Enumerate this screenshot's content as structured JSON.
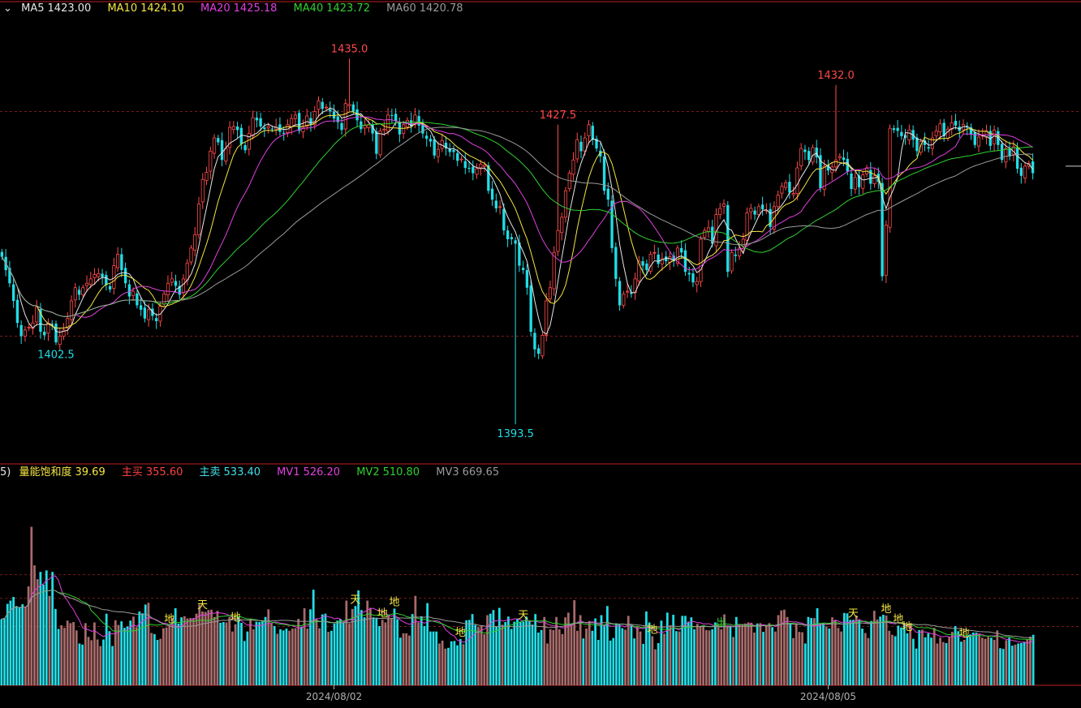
{
  "legend": {
    "ma": [
      {
        "label": "MA5",
        "value": "1423.00",
        "color": "#e6e6e6"
      },
      {
        "label": "MA10",
        "value": "1424.10",
        "color": "#f5e642"
      },
      {
        "label": "MA20",
        "value": "1425.18",
        "color": "#e040e0"
      },
      {
        "label": "MA40",
        "value": "1423.72",
        "color": "#30d030"
      },
      {
        "label": "MA60",
        "value": "1420.78",
        "color": "#9a9a9a"
      }
    ],
    "vol_prefix": "5)",
    "vol": [
      {
        "label": "量能饱和度",
        "value": "39.69",
        "color": "#f5e642"
      },
      {
        "label": "主买",
        "value": "355.60",
        "color": "#ff4040"
      },
      {
        "label": "主卖",
        "value": "533.40",
        "color": "#40e0e8"
      },
      {
        "label": "MV1",
        "value": "526.20",
        "color": "#e040e0"
      },
      {
        "label": "MV2",
        "value": "510.80",
        "color": "#30d030"
      },
      {
        "label": "MV3",
        "value": "669.65",
        "color": "#9a9a9a"
      }
    ]
  },
  "colors": {
    "up": "#ff4a4a",
    "down": "#22dde6",
    "grid": "#7a1a1a",
    "frame": "#c02020",
    "axis_text": "#b0b0b0"
  },
  "chart_data": [
    {
      "type": "candlestick",
      "ylim": [
        1389,
        1440
      ],
      "annotations": [
        {
          "label": "1435.0",
          "index": 90
        },
        {
          "label": "1402.5",
          "index": 14
        },
        {
          "label": "1427.5",
          "index": 144
        },
        {
          "label": "1393.5",
          "index": 133
        },
        {
          "label": "1432.0",
          "index": 216
        }
      ],
      "x_ticks": [
        {
          "label": "2024/08/02",
          "index": 86
        },
        {
          "label": "2024/08/05",
          "index": 214
        }
      ],
      "guide_levels": [
        1429.0,
        1403.5
      ],
      "right_marker": 1422.8,
      "close": [
        1412.5,
        1411.0,
        1409.5,
        1407.5,
        1405.0,
        1403.5,
        1404.2,
        1404.5,
        1405.0,
        1406.8,
        1404.0,
        1403.6,
        1405.0,
        1404.8,
        1402.8,
        1403.5,
        1404.2,
        1405.5,
        1407.5,
        1409.0,
        1408.2,
        1409.0,
        1409.5,
        1410.0,
        1410.5,
        1410.6,
        1410.2,
        1409.3,
        1408.8,
        1411.5,
        1412.8,
        1411.0,
        1409.5,
        1408.0,
        1408.6,
        1407.0,
        1406.5,
        1405.5,
        1406.5,
        1405.8,
        1405.2,
        1406.9,
        1408.3,
        1409.5,
        1410.0,
        1409.2,
        1408.2,
        1410.0,
        1411.8,
        1413.5,
        1415.0,
        1418.5,
        1421.3,
        1422.1,
        1424.5,
        1426.0,
        1425.5,
        1423.5,
        1424.8,
        1427.2,
        1427.3,
        1426.9,
        1425.3,
        1424.6,
        1426.5,
        1428.3,
        1428.0,
        1427.3,
        1427.0,
        1427.3,
        1427.0,
        1427.3,
        1426.7,
        1426.5,
        1427.5,
        1428.2,
        1428.6,
        1426.8,
        1427.2,
        1428.5,
        1427.5,
        1429.0,
        1430.2,
        1429.3,
        1429.5,
        1429.0,
        1428.2,
        1427.8,
        1426.9,
        1429.9,
        1429.8,
        1429.0,
        1428.0,
        1427.0,
        1427.4,
        1427.5,
        1426.5,
        1424.2,
        1426.8,
        1427.0,
        1428.6,
        1428.5,
        1427.9,
        1426.4,
        1427.5,
        1428.0,
        1427.3,
        1428.6,
        1427.4,
        1426.5,
        1425.9,
        1425.6,
        1424.0,
        1424.7,
        1425.7,
        1424.8,
        1424.4,
        1424.4,
        1423.4,
        1423.6,
        1422.6,
        1422.5,
        1422.0,
        1422.5,
        1423.0,
        1422.9,
        1420.0,
        1419.0,
        1418.0,
        1418.2,
        1415.5,
        1414.5,
        1414.5,
        1414.0,
        1411.5,
        1411.0,
        1409.0,
        1404.0,
        1402.0,
        1401.5,
        1403.6,
        1407.5,
        1409.0,
        1413.0,
        1415.5,
        1417.0,
        1420.0,
        1422.0,
        1423.5,
        1425.8,
        1424.5,
        1426.0,
        1427.5,
        1425.8,
        1424.8,
        1423.9,
        1420.0,
        1419.0,
        1413.5,
        1410.0,
        1407.0,
        1408.3,
        1408.6,
        1408.3,
        1410.0,
        1412.0,
        1411.5,
        1411.0,
        1412.8,
        1413.0,
        1411.7,
        1412.3,
        1412.0,
        1412.5,
        1412.0,
        1413.5,
        1413.0,
        1410.8,
        1410.5,
        1409.6,
        1409.7,
        1414.5,
        1415.5,
        1415.8,
        1414.0,
        1417.3,
        1418.0,
        1418.5,
        1410.8,
        1413.0,
        1412.6,
        1413.5,
        1414.5,
        1417.5,
        1418.0,
        1417.3,
        1418.2,
        1417.9,
        1417.8,
        1415.9,
        1418.2,
        1419.5,
        1420.5,
        1420.9,
        1419.8,
        1419.7,
        1422.6,
        1424.8,
        1424.4,
        1423.5,
        1424.9,
        1423.8,
        1420.3,
        1422.8,
        1422.3,
        1422.7,
        1423.5,
        1423.9,
        1423.5,
        1422.2,
        1420.2,
        1421.5,
        1420.4,
        1421.8,
        1422.6,
        1420.8,
        1421.7,
        1421.0,
        1410.3,
        1416.1,
        1427.1,
        1426.9,
        1426.8,
        1426.2,
        1426.0,
        1426.9,
        1425.8,
        1424.5,
        1425.6,
        1425.2,
        1424.8,
        1426.0,
        1426.8,
        1427.6,
        1426.2,
        1427.0,
        1427.7,
        1427.4,
        1426.8,
        1427.5,
        1427.2,
        1426.4,
        1425.2,
        1426.1,
        1426.3,
        1426.8,
        1425.1,
        1426.9,
        1425.2,
        1423.5,
        1424.8,
        1423.9,
        1425.0,
        1422.5,
        1421.7,
        1422.8,
        1423.1,
        1422.0
      ]
    },
    {
      "type": "bar",
      "series_levels": [
        355.6,
        533.4,
        526.2,
        510.8,
        669.65
      ],
      "markers": [
        {
          "label": "天",
          "index": 67
        },
        {
          "label": "地",
          "index": 56
        },
        {
          "label": "地",
          "index": 78
        },
        {
          "label": "天",
          "index": 118
        },
        {
          "label": "天",
          "index": 174
        },
        {
          "label": "地",
          "index": 127
        },
        {
          "label": "地",
          "index": 131
        },
        {
          "label": "地",
          "index": 153
        },
        {
          "label": "地",
          "index": 217
        },
        {
          "label": "出",
          "index": 240
        },
        {
          "label": "天",
          "index": 284
        },
        {
          "label": "地",
          "index": 295
        },
        {
          "label": "地",
          "index": 299
        },
        {
          "label": "地",
          "index": 302
        },
        {
          "label": "地",
          "index": 321
        }
      ],
      "values": [
        182,
        185,
        224,
        233,
        243,
        218,
        214,
        223,
        216,
        272,
        436,
        330,
        292,
        312,
        277,
        316,
        246,
        312,
        210,
        155,
        165,
        158,
        178,
        171,
        174,
        151,
        115,
        112,
        171,
        133,
        124,
        173,
        126,
        108,
        126,
        197,
        149,
        108,
        179,
        166,
        176,
        158,
        162,
        178,
        189,
        160,
        203,
        198,
        222,
        227,
        144,
        141,
        125,
        128,
        157,
        159,
        164,
        185,
        212,
        170,
        187,
        190,
        184,
        185,
        185,
        197,
        222,
        203,
        202,
        207,
        208,
        188,
        205,
        172,
        174,
        173,
        188,
        148,
        168,
        188,
        172,
        122,
        148,
        183,
        154,
        175,
        174,
        177,
        188,
        209,
        170,
        163,
        142,
        154,
        151,
        156,
        150,
        156,
        157,
        183,
        161,
        212,
        156,
        209,
        263,
        183,
        157,
        195,
        197,
        147,
        150,
        170,
        178,
        182,
        173,
        233,
        171,
        210,
        218,
        261,
        207,
        187,
        233,
        213,
        187,
        186,
        163,
        180,
        173,
        194,
        185,
        211,
        182,
        131,
        143,
        143,
        137,
        196,
        246,
        173,
        190,
        163,
        226,
        148,
        148,
        148,
        115,
        123,
        101,
        103,
        121,
        122,
        110,
        127,
        113,
        179,
        180,
        196,
        166,
        160,
        165,
        141,
        193,
        197,
        207,
        162,
        213,
        167,
        174,
        189,
        155,
        175,
        184,
        174,
        175,
        189,
        176,
        167,
        196,
        145,
        152,
        188,
        115,
        154,
        152,
        188,
        154,
        141,
        187,
        200,
        167,
        234,
        150,
        193,
        129,
        156,
        177,
        150,
        184,
        125,
        193,
        166,
        218,
        123,
        130,
        170,
        167,
        157,
        153,
        191,
        165,
        129,
        163,
        148,
        114,
        203,
        173,
        135,
        99,
        116,
        178,
        142,
        200,
        165,
        194,
        149,
        148,
        191,
        191,
        175,
        187,
        154,
        169,
        162,
        162,
        152,
        151,
        154,
        173,
        166,
        154,
        195,
        164,
        164,
        133,
        188,
        166,
        168,
        170,
        173,
        172,
        145,
        170,
        171,
        147,
        166,
        171,
        160,
        148,
        193,
        206,
        208,
        188,
        170,
        130,
        170,
        147,
        146,
        115,
        188,
        185,
        185,
        212,
        170,
        171,
        162,
        156,
        187,
        179,
        158,
        148,
        199,
        198,
        180,
        180,
        192,
        181,
        156,
        144,
        130,
        177,
        205,
        181,
        189,
        194,
        192,
        150,
        139,
        135,
        164,
        159,
        167,
        143,
        170,
        128,
        101,
        152,
        153,
        132,
        143,
        131,
        158,
        115,
        131,
        119,
        116,
        132,
        147,
        163,
        149,
        120,
        125,
        138,
        140,
        145,
        145,
        142,
        131,
        128,
        133,
        131,
        125,
        151,
        102,
        100,
        124,
        131,
        109,
        112,
        115,
        116,
        120,
        126,
        134,
        139
      ]
    }
  ]
}
